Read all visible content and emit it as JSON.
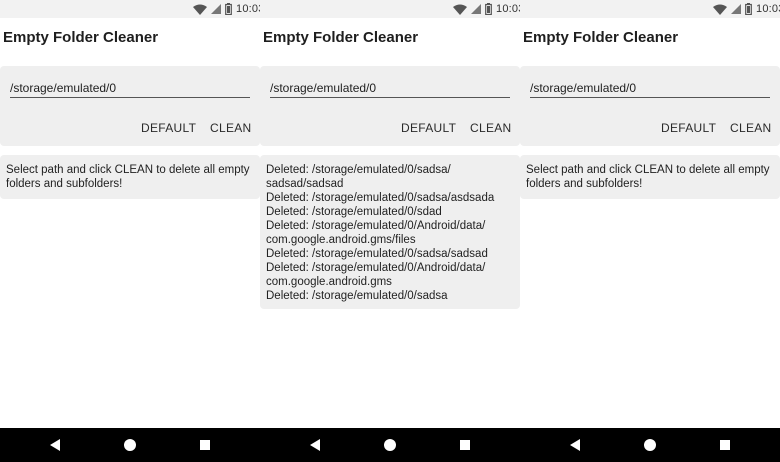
{
  "status_bar": {
    "time": "10:03"
  },
  "screens": [
    {
      "title": "Empty Folder Cleaner",
      "path_value": "/storage/emulated/0",
      "default_label": "DEFAULT",
      "clean_label": "CLEAN",
      "output": "Select path and click CLEAN to delete all empty folders and subfolders!"
    },
    {
      "title": "Empty Folder Cleaner",
      "path_value": "/storage/emulated/0",
      "default_label": "DEFAULT",
      "clean_label": "CLEAN",
      "output": "Deleted: /storage/emulated/0/sadsa/\nsadsad/sadsad\nDeleted: /storage/emulated/0/sadsa/asdsada\nDeleted: /storage/emulated/0/sdad\nDeleted: /storage/emulated/0/Android/data/\ncom.google.android.gms/files\nDeleted: /storage/emulated/0/sadsa/sadsad\nDeleted: /storage/emulated/0/Android/data/\ncom.google.android.gms\nDeleted: /storage/emulated/0/sadsa"
    },
    {
      "title": "Empty Folder Cleaner",
      "path_value": "/storage/emulated/0",
      "default_label": "DEFAULT",
      "clean_label": "CLEAN",
      "output": "Select path and click CLEAN to delete all empty folders and subfolders!"
    }
  ],
  "icons": {
    "wifi": "wifi-icon",
    "signal": "signal-icon",
    "battery": "battery-icon",
    "back": "back-icon",
    "home": "home-icon",
    "recents": "recents-icon"
  }
}
